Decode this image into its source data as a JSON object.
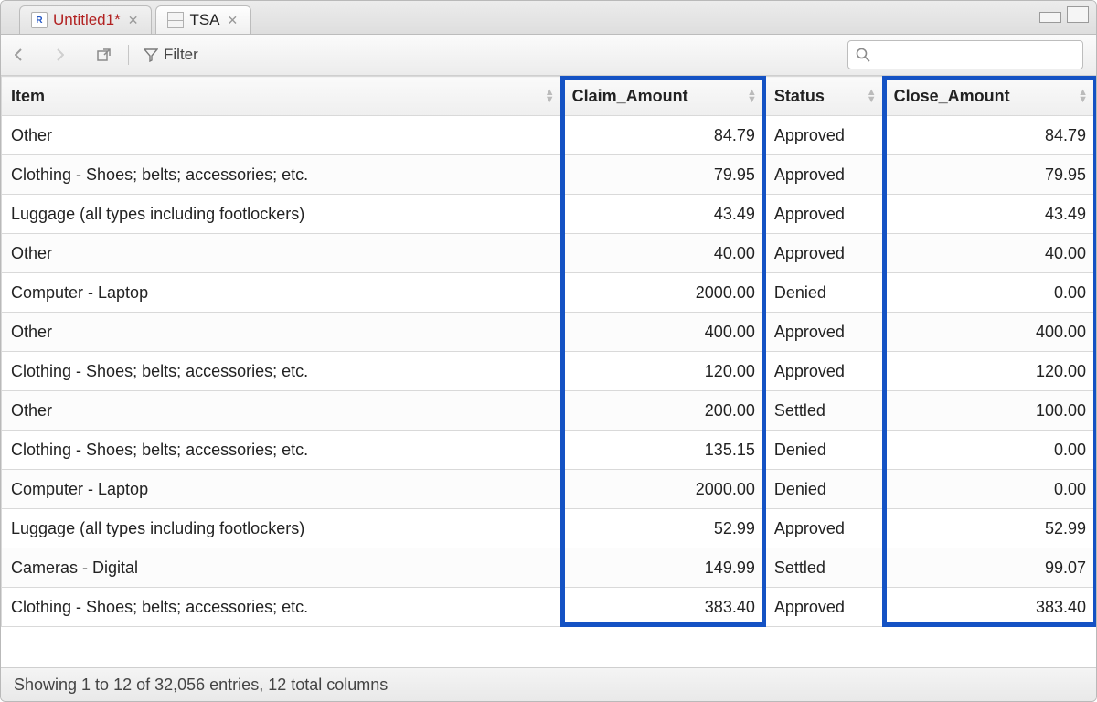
{
  "tabs": [
    {
      "label": "Untitled1*",
      "icon": "r-script",
      "unsaved": true
    },
    {
      "label": "TSA",
      "icon": "data-grid",
      "unsaved": false
    }
  ],
  "active_tab_index": 1,
  "toolbar": {
    "filter_label": "Filter"
  },
  "search": {
    "value": "",
    "placeholder": ""
  },
  "columns": [
    {
      "key": "item",
      "label": "Item",
      "align": "left"
    },
    {
      "key": "claim",
      "label": "Claim_Amount",
      "align": "right"
    },
    {
      "key": "status",
      "label": "Status",
      "align": "left"
    },
    {
      "key": "close",
      "label": "Close_Amount",
      "align": "right"
    }
  ],
  "rows": [
    {
      "item": "Other",
      "claim": "84.79",
      "status": "Approved",
      "close": "84.79"
    },
    {
      "item": "Clothing - Shoes; belts; accessories; etc.",
      "claim": "79.95",
      "status": "Approved",
      "close": "79.95"
    },
    {
      "item": "Luggage (all types including footlockers)",
      "claim": "43.49",
      "status": "Approved",
      "close": "43.49"
    },
    {
      "item": "Other",
      "claim": "40.00",
      "status": "Approved",
      "close": "40.00"
    },
    {
      "item": "Computer - Laptop",
      "claim": "2000.00",
      "status": "Denied",
      "close": "0.00"
    },
    {
      "item": "Other",
      "claim": "400.00",
      "status": "Approved",
      "close": "400.00"
    },
    {
      "item": "Clothing - Shoes; belts; accessories; etc.",
      "claim": "120.00",
      "status": "Approved",
      "close": "120.00"
    },
    {
      "item": "Other",
      "claim": "200.00",
      "status": "Settled",
      "close": "100.00"
    },
    {
      "item": "Clothing - Shoes; belts; accessories; etc.",
      "claim": "135.15",
      "status": "Denied",
      "close": "0.00"
    },
    {
      "item": "Computer - Laptop",
      "claim": "2000.00",
      "status": "Denied",
      "close": "0.00"
    },
    {
      "item": "Luggage (all types including footlockers)",
      "claim": "52.99",
      "status": "Approved",
      "close": "52.99"
    },
    {
      "item": "Cameras - Digital",
      "claim": "149.99",
      "status": "Settled",
      "close": "99.07"
    },
    {
      "item": "Clothing - Shoes; belts; accessories; etc.",
      "claim": "383.40",
      "status": "Approved",
      "close": "383.40"
    }
  ],
  "status_text": "Showing 1 to 12 of 32,056 entries, 12 total columns"
}
